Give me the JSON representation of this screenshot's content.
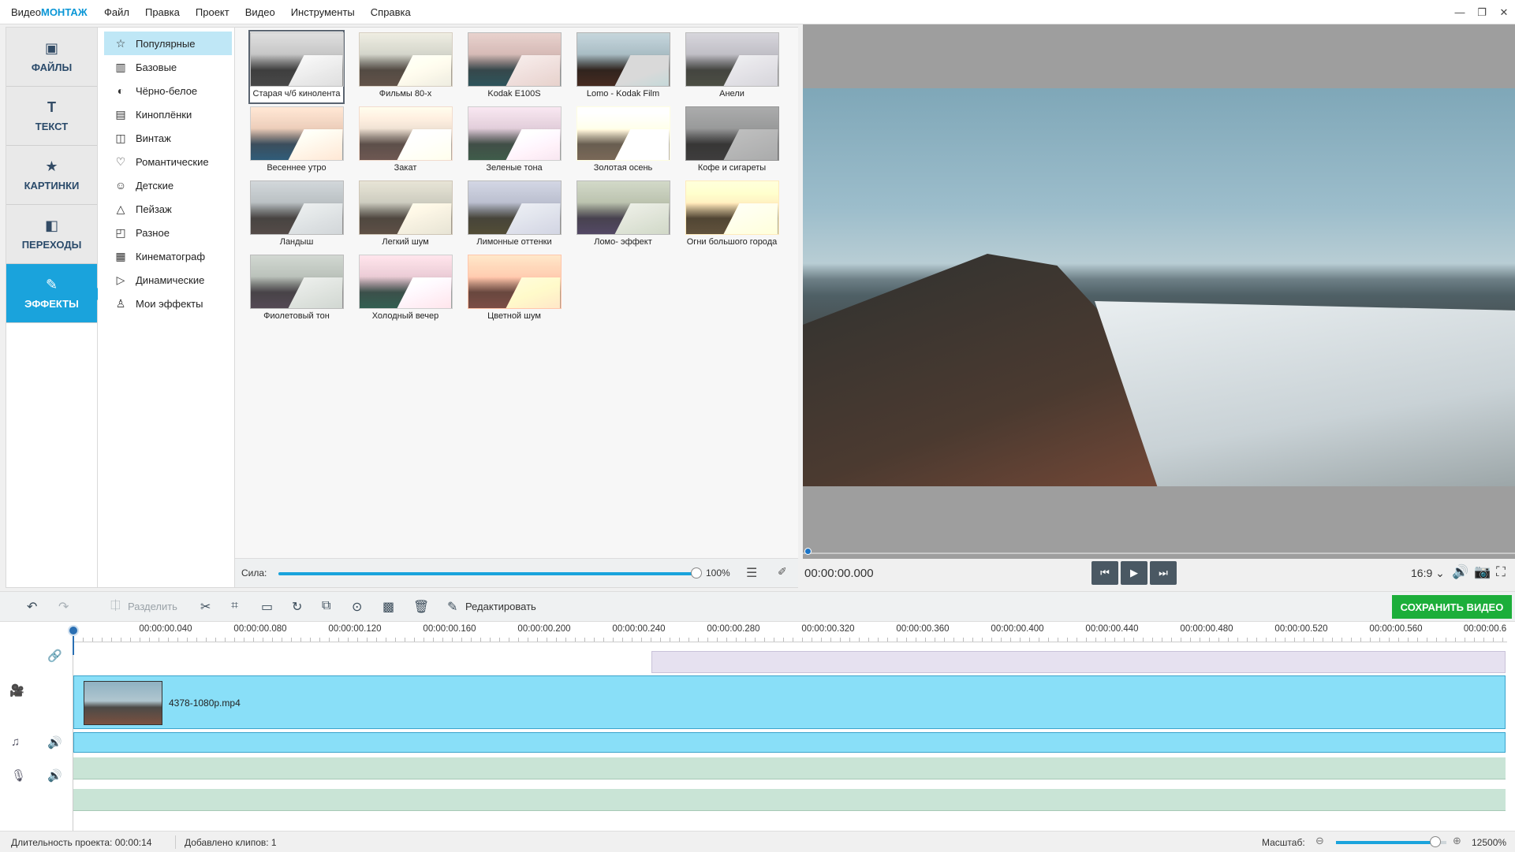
{
  "app": {
    "name_a": "Видео",
    "name_b": "МОНТАЖ"
  },
  "menu": [
    "Файл",
    "Правка",
    "Проект",
    "Видео",
    "Инструменты",
    "Справка"
  ],
  "window_controls": {
    "minimize": "—",
    "restore": "❐",
    "close": "✕"
  },
  "nav_tabs": [
    {
      "label": "ФАЙЛЫ",
      "icon": "image-icon",
      "glyph": "▣"
    },
    {
      "label": "ТЕКСТ",
      "icon": "text-icon",
      "glyph": "T"
    },
    {
      "label": "КАРТИНКИ",
      "icon": "star-icon",
      "glyph": "★"
    },
    {
      "label": "ПЕРЕХОДЫ",
      "icon": "transition-icon",
      "glyph": "◧"
    },
    {
      "label": "ЭФФЕКТЫ",
      "icon": "magic-wand-icon",
      "glyph": "✎"
    }
  ],
  "active_nav": 4,
  "categories": [
    {
      "label": "Популярные",
      "glyph": "☆"
    },
    {
      "label": "Базовые",
      "glyph": "▥"
    },
    {
      "label": "Чёрно-белое",
      "glyph": "◐"
    },
    {
      "label": "Киноплёнки",
      "glyph": "▤"
    },
    {
      "label": "Винтаж",
      "glyph": "◫"
    },
    {
      "label": "Романтические",
      "glyph": "♡"
    },
    {
      "label": "Детские",
      "glyph": "☺"
    },
    {
      "label": "Пейзаж",
      "glyph": "△"
    },
    {
      "label": "Разное",
      "glyph": "◰"
    },
    {
      "label": "Кинематограф",
      "glyph": "▦"
    },
    {
      "label": "Динамические",
      "glyph": "▷"
    },
    {
      "label": "Мои эффекты",
      "glyph": "♙"
    }
  ],
  "active_category": 0,
  "effects": [
    "Старая ч/б кинолента",
    "Фильмы 80-х",
    "Kodak E100S",
    "Lomo - Kodak Film",
    "Анели",
    "Весеннее утро",
    "Закат",
    "Зеленые тона",
    "Золотая осень",
    "Кофе и сигареты",
    "Ландыш",
    "Легкий шум",
    "Лимонные оттенки",
    "Ломо- эффект",
    "Огни большого города",
    "Фиолетовый тон",
    "Холодный вечер",
    "Цветной шум"
  ],
  "selected_effect": 0,
  "strength": {
    "label": "Сила:",
    "value_text": "100%",
    "value": 1.0
  },
  "player": {
    "time": "00:00:00.000",
    "prev": "⏮",
    "play": "▶",
    "next": "⏭",
    "ratio": "16:9 ⌄",
    "volume_glyph": "🔊",
    "snapshot_glyph": "📷",
    "fullscreen_glyph": "⛶",
    "progress": 0.0
  },
  "toolbar": {
    "undo": "↶",
    "redo": "↷",
    "split_label": "Разделить",
    "split_glyph": "⎅",
    "cut": "✂",
    "crop": "⌗",
    "fill": "▭",
    "rotate": "↻",
    "transform": "⧉",
    "stabilize": "⊙",
    "effects": "▩",
    "delete": "🗑",
    "edit_glyph": "✎",
    "edit_label": "Редактировать",
    "save_label": "СОХРАНИТЬ ВИДЕО"
  },
  "timeline": {
    "ticks": [
      "00:00:00.040",
      "00:00:00.080",
      "00:00:00.120",
      "00:00:00.160",
      "00:00:00.200",
      "00:00:00.240",
      "00:00:00.280",
      "00:00:00.320",
      "00:00:00.360",
      "00:00:00.400",
      "00:00:00.440",
      "00:00:00.480",
      "00:00:00.520",
      "00:00:00.560",
      "00:00:00.6"
    ],
    "clip_name": "4378-1080p.mp4",
    "gutter": {
      "link": "🔗",
      "camera": "🎥",
      "music": "♫",
      "mic": "🎙",
      "speaker": "🔊"
    }
  },
  "status": {
    "duration": "Длительность проекта:  00:00:14",
    "clips": "Добавлено клипов: 1",
    "scale_label": "Масштаб:",
    "zoom_minus": "⊖",
    "zoom_plus": "⊕",
    "zoom_value": "12500%",
    "zoom_level": 0.9
  },
  "colors": {
    "accent": "#1aa3dc",
    "save": "#1cae3a",
    "brand": "#0a96d6"
  }
}
